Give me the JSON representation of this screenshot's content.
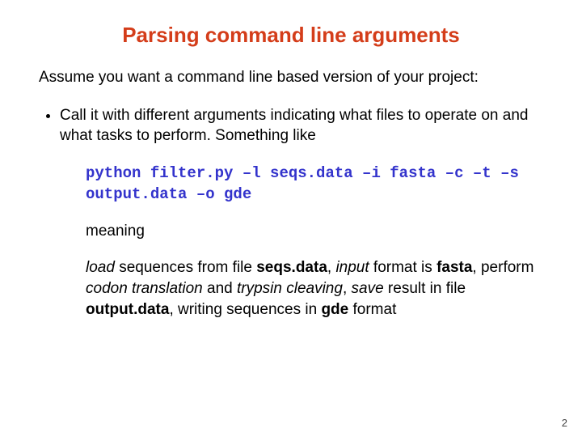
{
  "title": "Parsing command line arguments",
  "intro": "Assume you want a command line based version of your project:",
  "bullet": "Call it with different arguments indicating what files to operate on and what tasks to perform. Something like",
  "code_line1": "python filter.py –l seqs.data –i fasta –c –t –s",
  "code_line2": "output.data –o gde",
  "meaning_label": "meaning",
  "explain": {
    "w1": "load",
    "t1": " sequences from file ",
    "b1": "seqs.data",
    "t2": ", ",
    "w2": "input",
    "t3": " format is ",
    "b2": "fasta",
    "t4": ", perform ",
    "w3": "codon translation",
    "t5": " and ",
    "w4": "trypsin cleaving",
    "t6": ", ",
    "w5": "save",
    "t7": " result in file ",
    "b3": "output.data",
    "t8": ", writing sequences in ",
    "b4": "gde",
    "t9": " format"
  },
  "page_number": "2"
}
